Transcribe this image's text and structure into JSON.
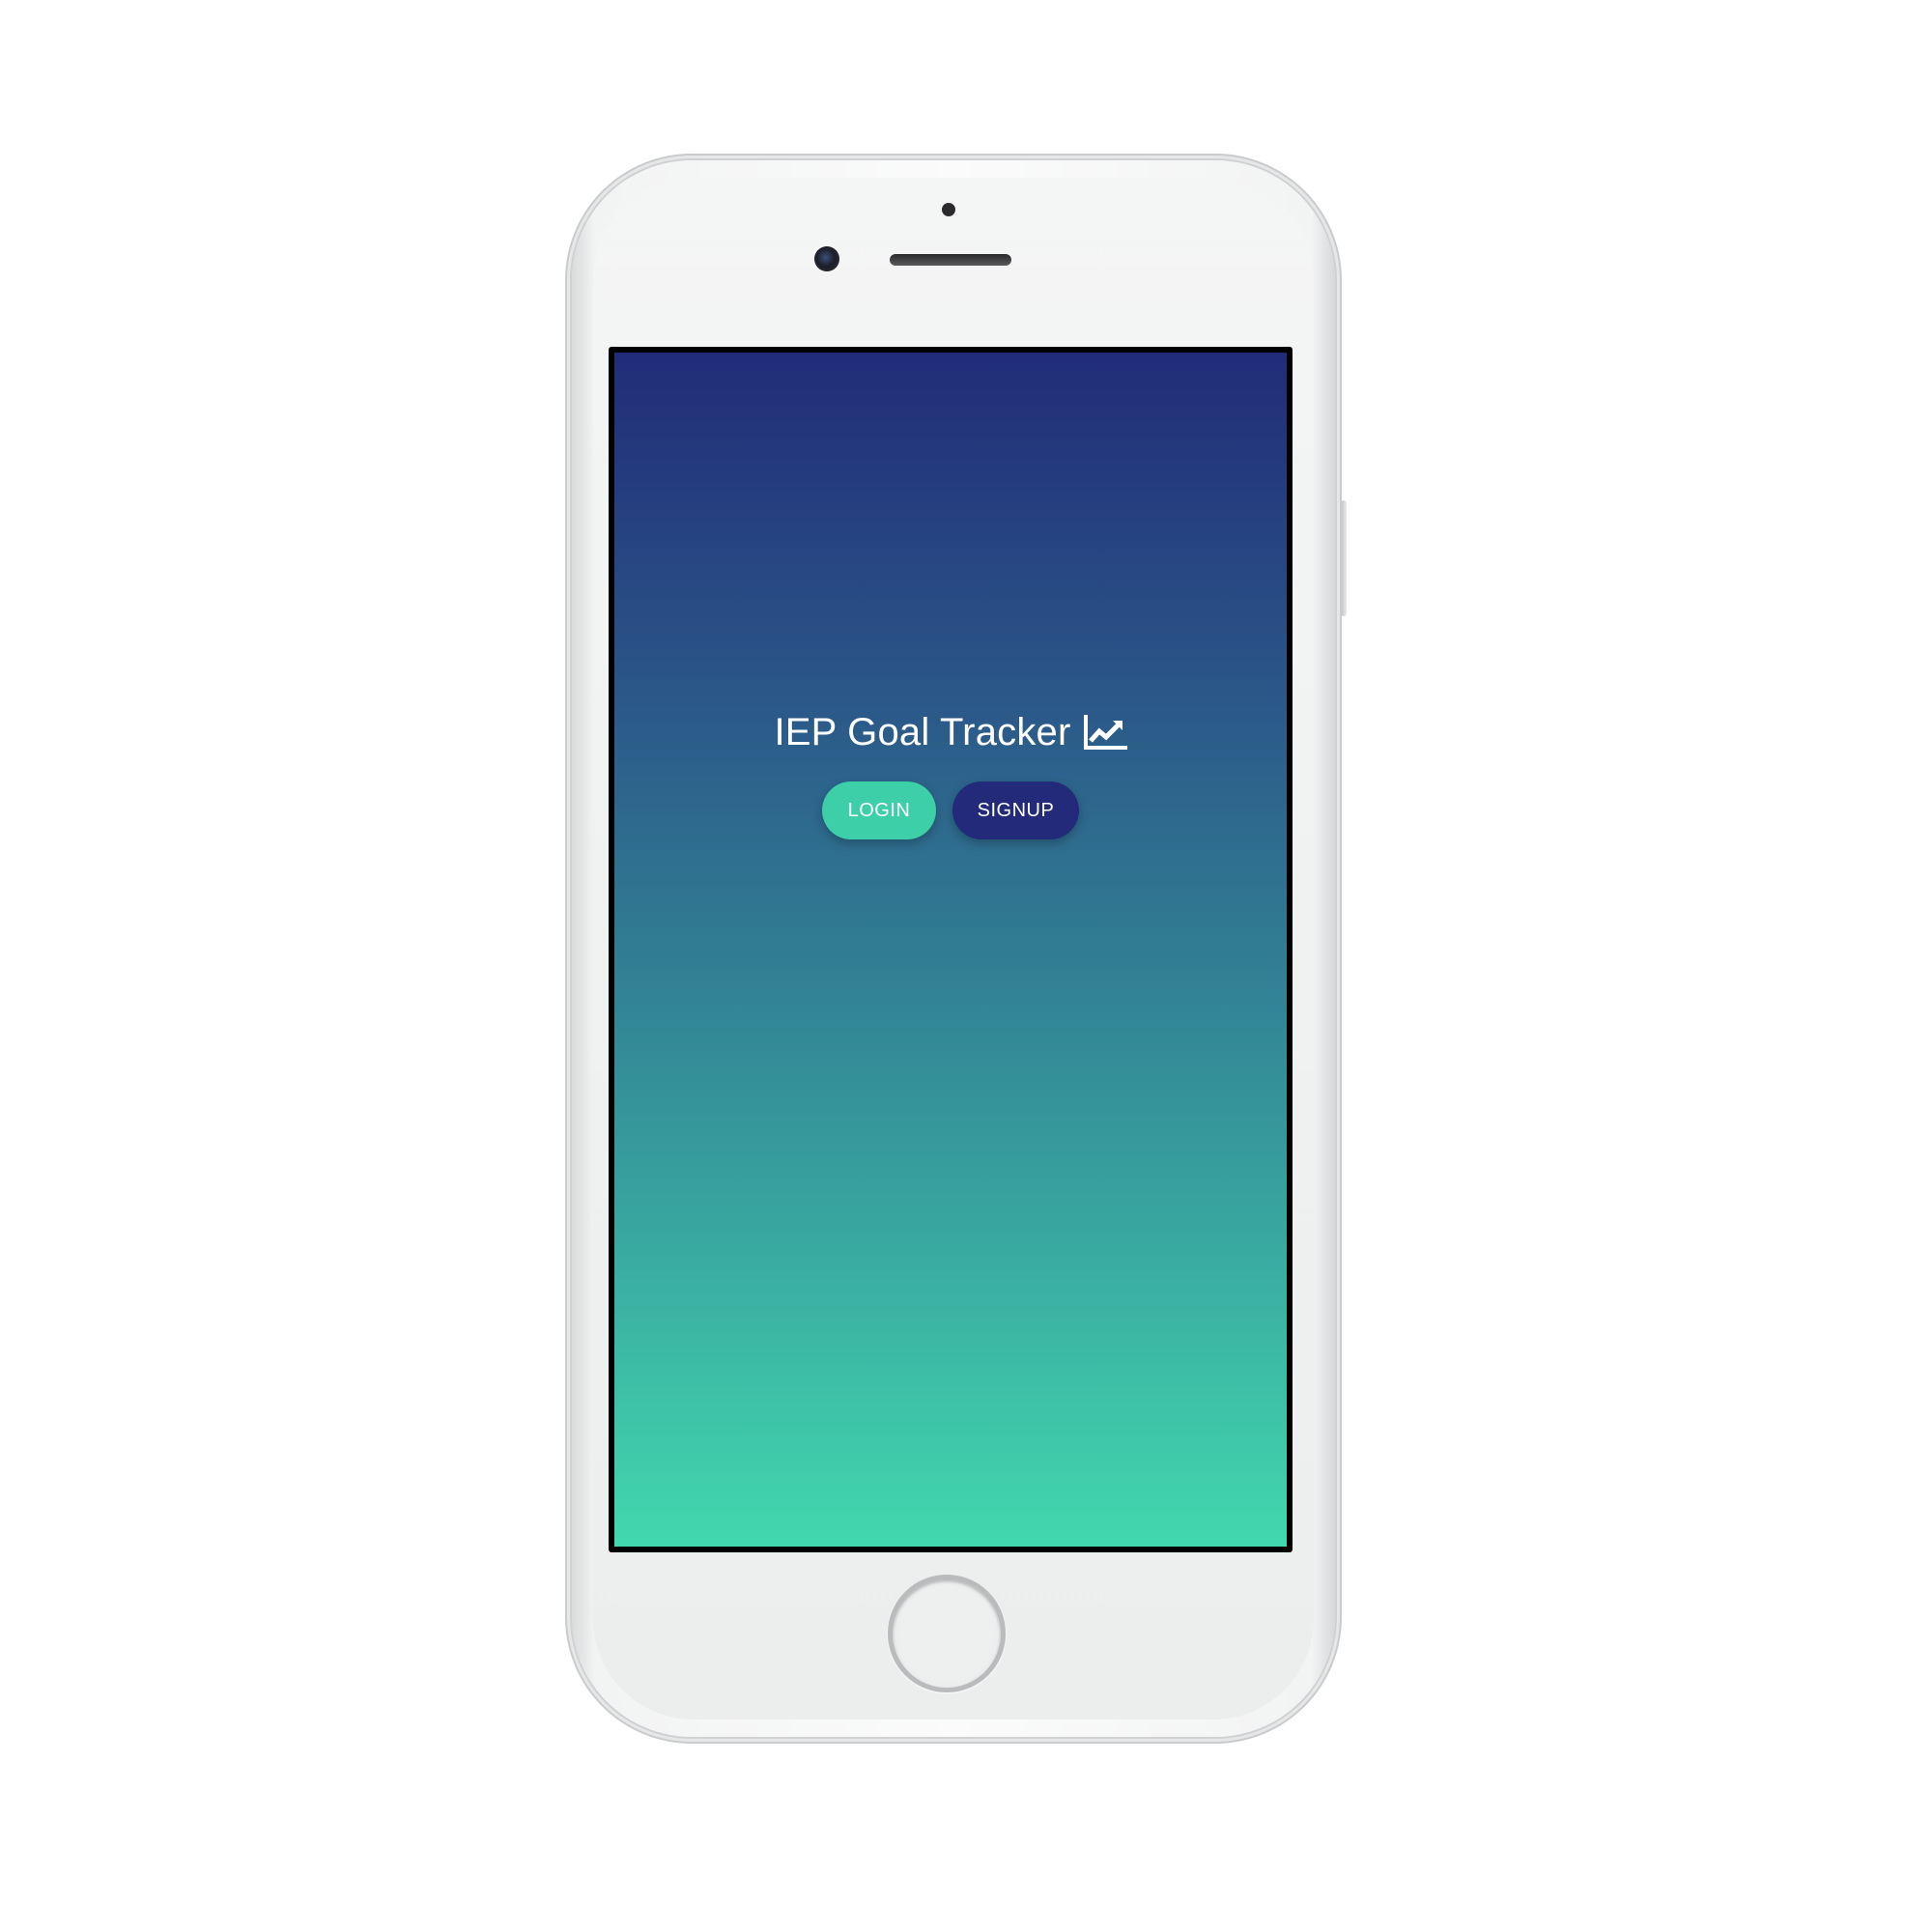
{
  "app": {
    "title": "IEP Goal Tracker",
    "title_icon": "chart-line-icon"
  },
  "buttons": {
    "login_label": "LOGIN",
    "signup_label": "SIGNUP"
  },
  "colors": {
    "gradient_top": "#212c78",
    "gradient_bottom": "#42d8ae",
    "login_button": "#3dcfa8",
    "signup_button": "#222a79",
    "text": "#ffffff"
  },
  "device": {
    "model": "white-iphone-frame"
  }
}
